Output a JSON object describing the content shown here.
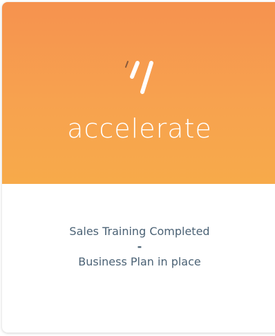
{
  "card": {
    "brand": "accelerate",
    "logo_icon": "accelerate-slash-icon",
    "colors": {
      "gradient_top": "#f6924f",
      "gradient_bottom": "#f7aa4a",
      "text": "#4b6275",
      "brand_text": "#ffffff",
      "logo_accent": "#8a5a3a"
    },
    "lines": [
      "Sales Training Completed",
      "-",
      "Business Plan in place"
    ]
  }
}
